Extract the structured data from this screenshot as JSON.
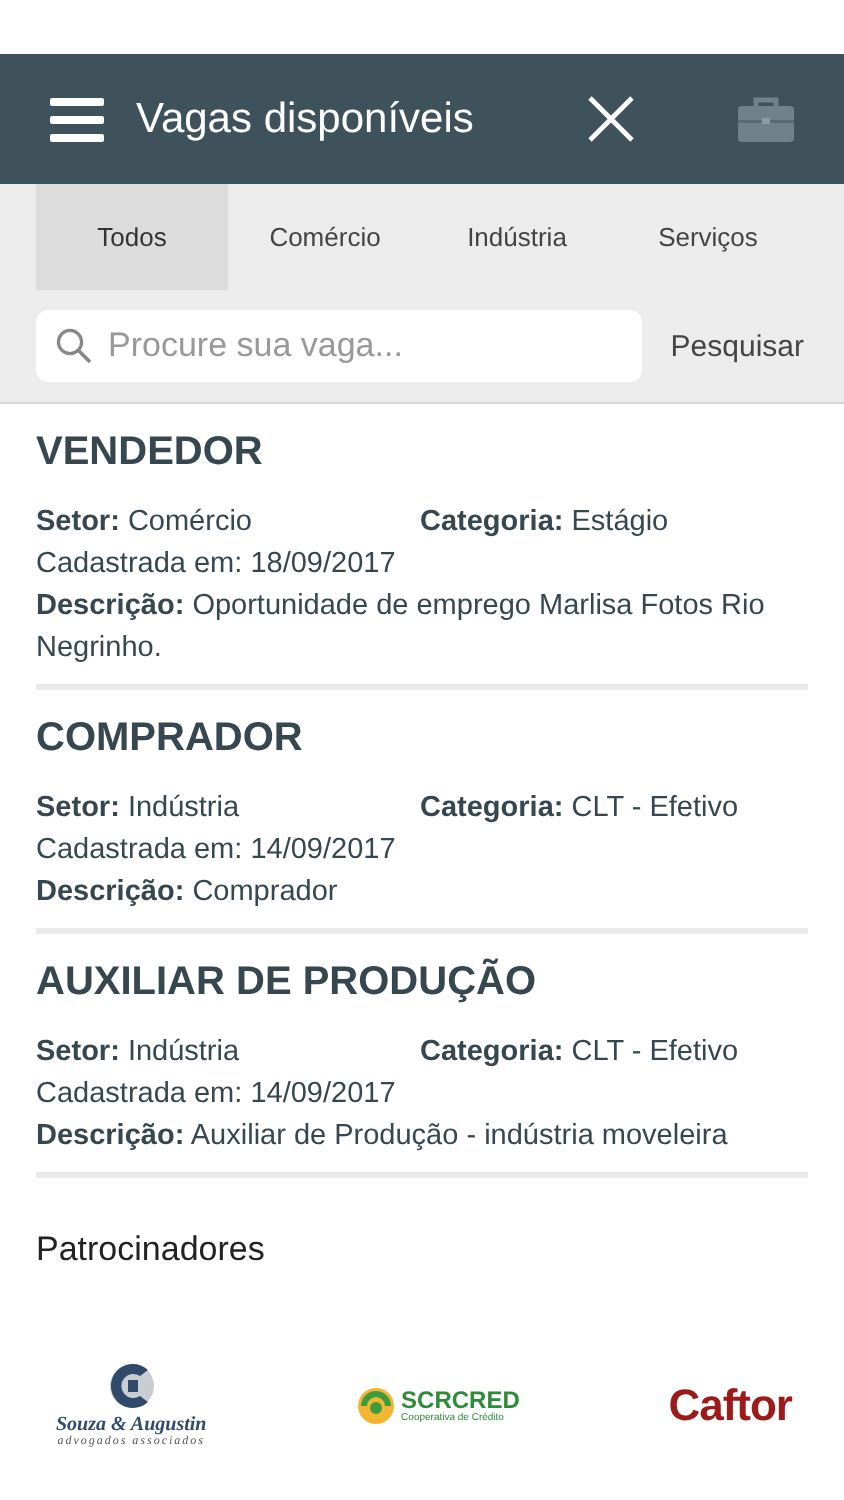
{
  "header": {
    "title": "Vagas disponíveis"
  },
  "tabs": [
    {
      "label": "Todos",
      "selected": true
    },
    {
      "label": "Comércio",
      "selected": false
    },
    {
      "label": "Indústria",
      "selected": false
    },
    {
      "label": "Serviços",
      "selected": false
    }
  ],
  "search": {
    "placeholder": "Procure sua vaga...",
    "button": "Pesquisar"
  },
  "jobs": [
    {
      "title": "VENDEDOR",
      "sector_label": "Setor:",
      "sector": "Comércio",
      "category_label": "Categoria:",
      "category": "Estágio",
      "registered": "Cadastrada em: 18/09/2017",
      "description_label": "Descrição:",
      "description": "Oportunidade de emprego Marlisa Fotos Rio Negrinho."
    },
    {
      "title": "COMPRADOR",
      "sector_label": "Setor:",
      "sector": "Indústria",
      "category_label": "Categoria:",
      "category": "CLT - Efetivo",
      "registered": "Cadastrada em: 14/09/2017",
      "description_label": "Descrição:",
      "description": "Comprador"
    },
    {
      "title": "AUXILIAR DE PRODUÇÃO",
      "sector_label": "Setor:",
      "sector": "Indústria",
      "category_label": "Categoria:",
      "category": "CLT - Efetivo",
      "registered": "Cadastrada em: 14/09/2017",
      "description_label": "Descrição:",
      "description": "Auxiliar de Produção - indústria moveleira"
    }
  ],
  "sponsors": {
    "heading": "Patrocinadores",
    "logos": [
      {
        "kind": "emblem",
        "name": "Souza & Augustin",
        "subtitle": "advogados associados"
      },
      {
        "kind": "badge",
        "name": "SCRCRED",
        "subtitle": "Cooperativa de Crédito"
      },
      {
        "kind": "wordmark",
        "name": "Caftor"
      }
    ]
  }
}
